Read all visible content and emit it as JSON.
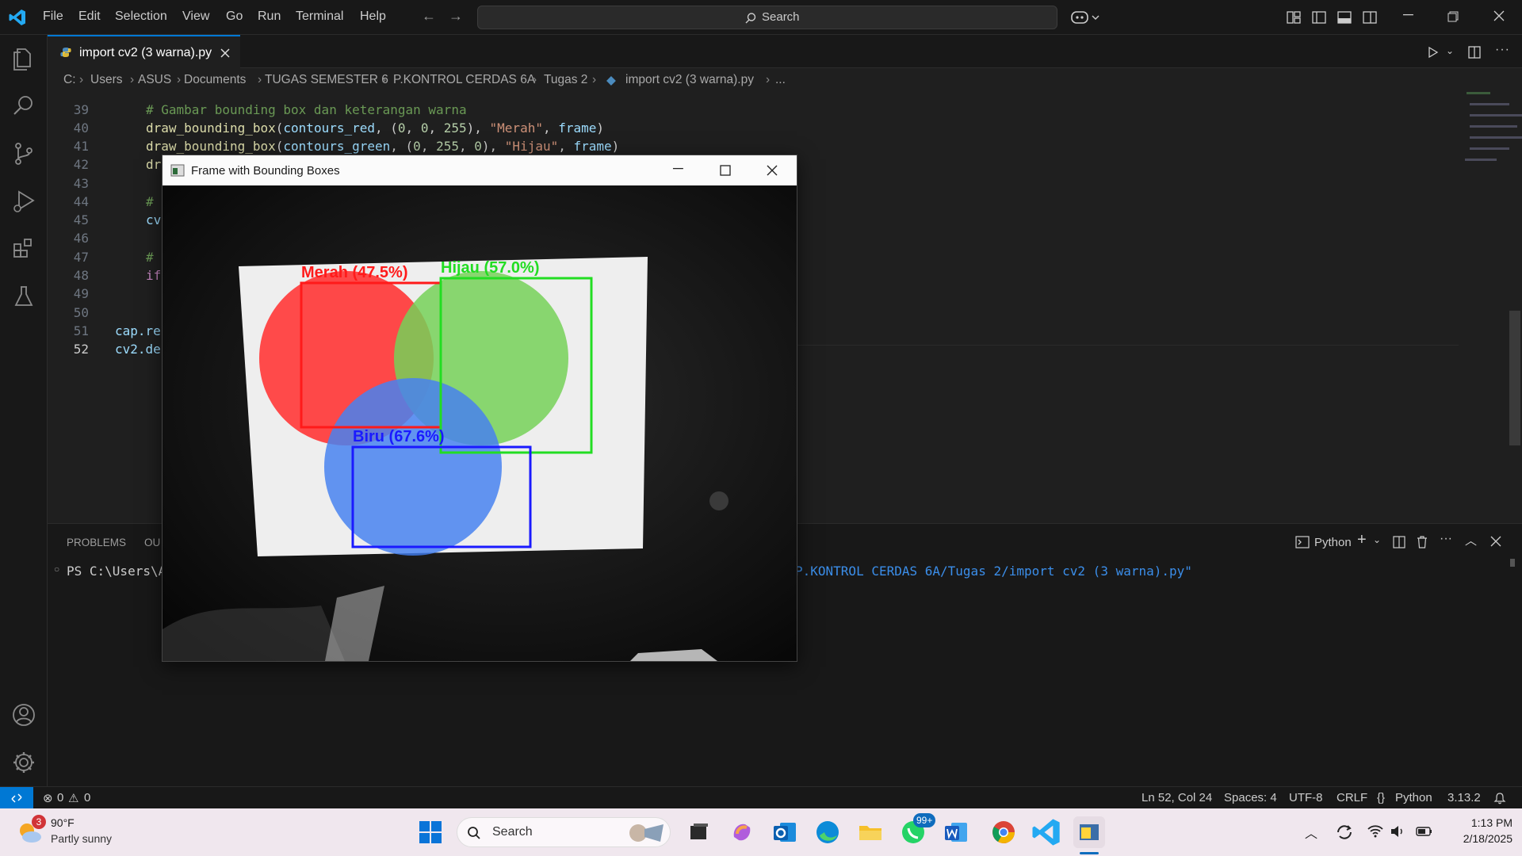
{
  "menu": [
    "File",
    "Edit",
    "Selection",
    "View",
    "Go",
    "Run",
    "Terminal",
    "Help"
  ],
  "search": {
    "label": "Search"
  },
  "tab": {
    "title": "import cv2 (3 warna).py"
  },
  "breadcrumb": [
    "C:",
    "Users",
    "ASUS",
    "Documents",
    "TUGAS SEMESTER 6",
    "P.KONTROL CERDAS 6A",
    "Tugas 2",
    "import cv2 (3 warna).py",
    "..."
  ],
  "editor": {
    "line_numbers": [
      "39",
      "40",
      "41",
      "42",
      "43",
      "44",
      "45",
      "46",
      "47",
      "48",
      "49",
      "50",
      "51",
      "52"
    ],
    "lines": {
      "l39": "# Gambar bounding box dan keterangan warna",
      "l40_fn": "draw_bounding_box",
      "l40_arg": "contours_red",
      "l40_n1": "0",
      "l40_n2": "0",
      "l40_n3": "255",
      "l40_str": "\"Merah\"",
      "l40_var": "frame",
      "l41_fn": "draw_bounding_box",
      "l41_arg": "contours_green",
      "l41_n1": "0",
      "l41_n2": "255",
      "l41_n3": "0",
      "l41_str": "\"Hijau\"",
      "l41_var": "frame",
      "l42": "dr",
      "l44": "#",
      "l45": "cv",
      "l47": "#",
      "l48": "if",
      "l51": "cap.re",
      "l52": "cv2.de"
    }
  },
  "panel": {
    "tabs": [
      "PROBLEMS",
      "OU"
    ],
    "terminal_type": "Python",
    "prompt": "PS C:\\Users\\A",
    "path_tail": "P.KONTROL CERDAS 6A/Tugas 2/import cv2 (3 warna).py\""
  },
  "cv_window": {
    "title": "Frame with Bounding Boxes",
    "labels": {
      "red": "Merah (47.5%)",
      "green": "Hijau (57.0%)",
      "blue": "Biru (67.6%)"
    }
  },
  "status": {
    "errors": "0",
    "warnings": "0",
    "position": "Ln 52, Col 24",
    "spaces": "Spaces: 4",
    "encoding": "UTF-8",
    "eol": "CRLF",
    "language": "Python",
    "version": "3.13.2"
  },
  "taskbar": {
    "weather_temp": "90°F",
    "weather_desc": "Partly sunny",
    "weather_badge": "3",
    "search_label": "Search",
    "whatsapp_badge": "99+",
    "time": "1:13 PM",
    "date": "2/18/2025"
  },
  "colors": {
    "accent": "#0078d4",
    "editor_bg": "#1f1f1f",
    "box_red": "#ff1a1a",
    "box_green": "#22dd22",
    "box_blue": "#1a1aff"
  }
}
